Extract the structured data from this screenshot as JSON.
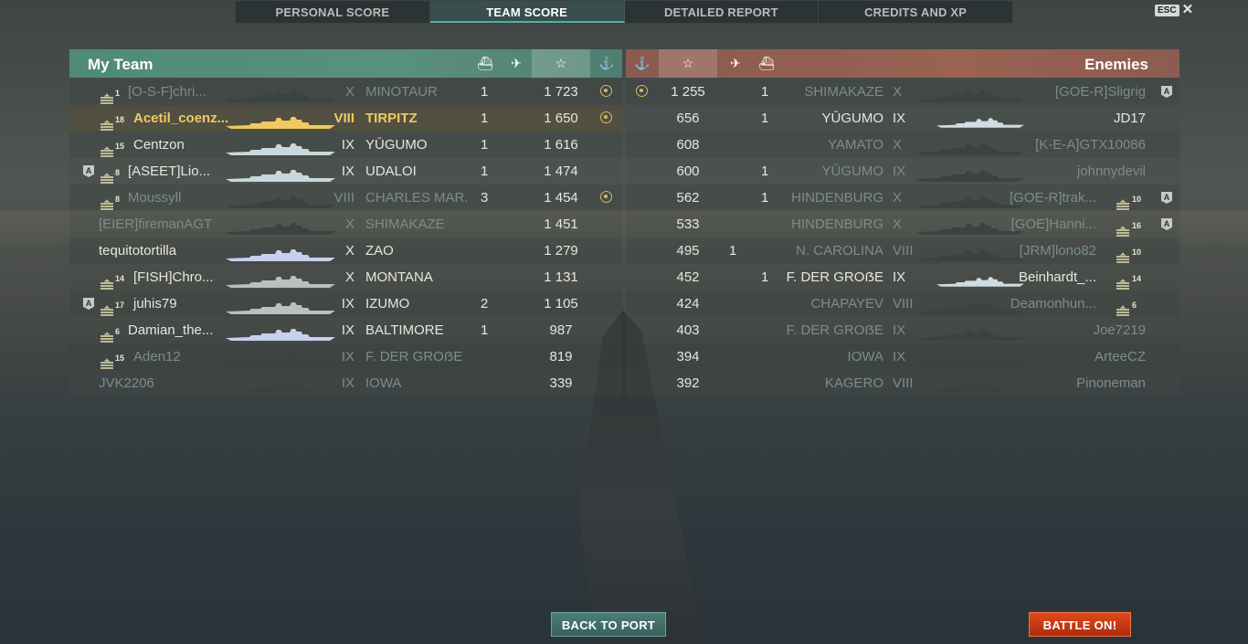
{
  "tabs": [
    {
      "label": "PERSONAL SCORE",
      "active": false
    },
    {
      "label": "TEAM SCORE",
      "active": true
    },
    {
      "label": "DETAILED REPORT",
      "active": false
    },
    {
      "label": "CREDITS AND XP",
      "active": false
    }
  ],
  "esc": {
    "key_label": "ESC",
    "close_glyph": "✕"
  },
  "my_team": {
    "title": "My Team",
    "header_icons": [
      "ship-sunk-icon",
      "planes-destroyed-icon",
      "star-icon",
      "base-capture-icon"
    ],
    "header_glyphs": {
      "sunk": "⛴",
      "planes": "✈",
      "star": "☆",
      "capture": "⚓"
    },
    "players": [
      {
        "division": "",
        "rank": "1",
        "name": "[O-S-F]chri...",
        "tier": "X",
        "ship": "MINOTAUR",
        "sunk": "1",
        "score": "1 723",
        "capture": true,
        "dim": true,
        "self": false,
        "ship_color": "#3a4342"
      },
      {
        "division": "",
        "rank": "18",
        "name": "Acetil_coenz...",
        "tier": "VIII",
        "ship": "TIRPITZ",
        "sunk": "1",
        "score": "1 650",
        "capture": true,
        "dim": false,
        "self": true,
        "ship_color": "#f2c863"
      },
      {
        "division": "",
        "rank": "15",
        "name": "Centzon",
        "tier": "IX",
        "ship": "YŪGUMO",
        "sunk": "1",
        "score": "1 616",
        "capture": false,
        "dim": false,
        "self": false,
        "ship_color": "#c8d8dc"
      },
      {
        "division": "A",
        "rank": "8",
        "name": "[ASEET]Lio...",
        "tier": "IX",
        "ship": "UDALOI",
        "sunk": "1",
        "score": "1 474",
        "capture": false,
        "dim": false,
        "self": false,
        "ship_color": "#c8d8dc"
      },
      {
        "division": "",
        "rank": "8",
        "name": "Moussyll",
        "tier": "VIII",
        "ship": "CHARLES MAR...",
        "sunk": "3",
        "score": "1 454",
        "capture": true,
        "dim": true,
        "self": false,
        "ship_color": "#3a4342"
      },
      {
        "division": "",
        "rank": "",
        "name": "[EIER]firemanAGT",
        "tier": "X",
        "ship": "SHIMAKAZE",
        "sunk": "",
        "score": "1 451",
        "capture": false,
        "dim": true,
        "self": false,
        "ship_color": "#3a4342"
      },
      {
        "division": "",
        "rank": "",
        "name": "tequitotortilla",
        "tier": "X",
        "ship": "ZAO",
        "sunk": "",
        "score": "1 279",
        "capture": false,
        "dim": false,
        "self": false,
        "ship_color": "#c8d0f0"
      },
      {
        "division": "",
        "rank": "14",
        "name": "[FISH]Chro...",
        "tier": "X",
        "ship": "MONTANA",
        "sunk": "",
        "score": "1 131",
        "capture": false,
        "dim": false,
        "self": false,
        "ship_color": "#b8c0c0"
      },
      {
        "division": "A",
        "rank": "17",
        "name": "juhis79",
        "tier": "IX",
        "ship": "IZUMO",
        "sunk": "2",
        "score": "1 105",
        "capture": false,
        "dim": false,
        "self": false,
        "ship_color": "#b8c0c0"
      },
      {
        "division": "",
        "rank": "6",
        "name": "Damian_the...",
        "tier": "IX",
        "ship": "BALTIMORE",
        "sunk": "1",
        "score": "987",
        "capture": false,
        "dim": false,
        "self": false,
        "ship_color": "#c8d0f0"
      },
      {
        "division": "",
        "rank": "15",
        "name": "Aden12",
        "tier": "IX",
        "ship": "F. DER GROẞE",
        "sunk": "",
        "score": "819",
        "capture": false,
        "dim": true,
        "self": false,
        "ship_color": "#3a4342"
      },
      {
        "division": "",
        "rank": "",
        "name": "JVK2206",
        "tier": "IX",
        "ship": "IOWA",
        "sunk": "",
        "score": "339",
        "capture": false,
        "dim": true,
        "self": false,
        "ship_color": "#3a4342"
      }
    ]
  },
  "enemies": {
    "title": "Enemies",
    "players": [
      {
        "capture": true,
        "score": "1 255",
        "planes": "",
        "sunk": "1",
        "ship": "SHIMAKAZE",
        "tier": "X",
        "name": "[GOE-R]Sligrig",
        "rank": "",
        "division": "A",
        "dim": true,
        "ship_color": "#3a4342"
      },
      {
        "capture": false,
        "score": "656",
        "planes": "",
        "sunk": "1",
        "ship": "YŪGUMO",
        "tier": "IX",
        "name": "JD17",
        "rank": "",
        "division": "",
        "dim": false,
        "ship_color": "#d0dce0"
      },
      {
        "capture": false,
        "score": "608",
        "planes": "",
        "sunk": "",
        "ship": "YAMATO",
        "tier": "X",
        "name": "[K-E-A]GTX10086",
        "rank": "",
        "division": "",
        "dim": true,
        "ship_color": "#3a4342"
      },
      {
        "capture": false,
        "score": "600",
        "planes": "",
        "sunk": "1",
        "ship": "YŪGUMO",
        "tier": "IX",
        "name": "johnnydevil",
        "rank": "",
        "division": "",
        "dim": true,
        "ship_color": "#3a4342"
      },
      {
        "capture": false,
        "score": "562",
        "planes": "",
        "sunk": "1",
        "ship": "HINDENBURG",
        "tier": "X",
        "name": "[GOE-R]trak...",
        "rank": "10",
        "division": "A",
        "dim": true,
        "ship_color": "#3a4342"
      },
      {
        "capture": false,
        "score": "533",
        "planes": "",
        "sunk": "",
        "ship": "HINDENBURG",
        "tier": "X",
        "name": "[GOE]Hanni...",
        "rank": "16",
        "division": "A",
        "dim": true,
        "ship_color": "#3a4342"
      },
      {
        "capture": false,
        "score": "495",
        "planes": "1",
        "sunk": "",
        "ship": "N. CAROLINA",
        "tier": "VIII",
        "name": "[JRM]lono82",
        "rank": "10",
        "division": "",
        "dim": true,
        "ship_color": "#3a4342"
      },
      {
        "capture": false,
        "score": "452",
        "planes": "",
        "sunk": "1",
        "ship": "F. DER GROẞE",
        "tier": "IX",
        "name": "Beinhardt_...",
        "rank": "14",
        "division": "",
        "dim": false,
        "ship_color": "#d0dce0"
      },
      {
        "capture": false,
        "score": "424",
        "planes": "",
        "sunk": "",
        "ship": "CHAPAYEV",
        "tier": "VIII",
        "name": "Deamonhun...",
        "rank": "6",
        "division": "",
        "dim": true,
        "ship_color": "#3a4342"
      },
      {
        "capture": false,
        "score": "403",
        "planes": "",
        "sunk": "",
        "ship": "F. DER GROẞE",
        "tier": "IX",
        "name": "Joe7219",
        "rank": "",
        "division": "",
        "dim": true,
        "ship_color": "#3a4342"
      },
      {
        "capture": false,
        "score": "394",
        "planes": "",
        "sunk": "",
        "ship": "IOWA",
        "tier": "IX",
        "name": "ArteeCZ",
        "rank": "",
        "division": "",
        "dim": true,
        "ship_color": "#3a4342"
      },
      {
        "capture": false,
        "score": "392",
        "planes": "",
        "sunk": "",
        "ship": "KAGERO",
        "tier": "VIII",
        "name": "Pinoneman",
        "rank": "",
        "division": "",
        "dim": true,
        "ship_color": "#3a4342"
      }
    ]
  },
  "buttons": {
    "back_to_port": "BACK TO PORT",
    "battle_on": "BATTLE ON!"
  }
}
